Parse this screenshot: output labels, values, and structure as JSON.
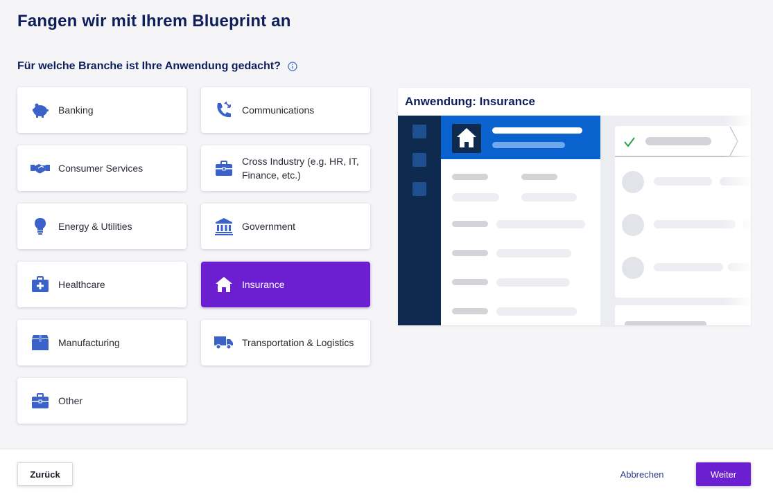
{
  "header": {
    "title": "Fangen wir mit Ihrem Blueprint an",
    "question": "Für welche Branche ist Ihre Anwendung gedacht?"
  },
  "colors": {
    "accent": "#6b1fd1",
    "icon": "#3b62c8",
    "title": "#0e1e5b",
    "sidebar": "#0e2a4f",
    "highlight": "#0a62cf"
  },
  "industries": [
    {
      "label": "Banking",
      "icon": "piggy-bank-icon"
    },
    {
      "label": "Communications",
      "icon": "phone-icon"
    },
    {
      "label": "Consumer Services",
      "icon": "handshake-icon"
    },
    {
      "label": "Cross Industry (e.g. HR, IT, Finance, etc.)",
      "icon": "briefcase-icon"
    },
    {
      "label": "Energy & Utilities",
      "icon": "lightbulb-icon"
    },
    {
      "label": "Government",
      "icon": "government-building-icon"
    },
    {
      "label": "Healthcare",
      "icon": "medical-kit-icon"
    },
    {
      "label": "Insurance",
      "icon": "house-icon",
      "selected": true
    },
    {
      "label": "Manufacturing",
      "icon": "box-icon"
    },
    {
      "label": "Transportation & Logistics",
      "icon": "truck-icon"
    },
    {
      "label": "Other",
      "icon": "briefcase-icon"
    }
  ],
  "preview": {
    "title": "Anwendung: Insurance",
    "icon": "house-icon"
  },
  "footer": {
    "back_label": "Zurück",
    "cancel_label": "Abbrechen",
    "next_label": "Weiter"
  }
}
